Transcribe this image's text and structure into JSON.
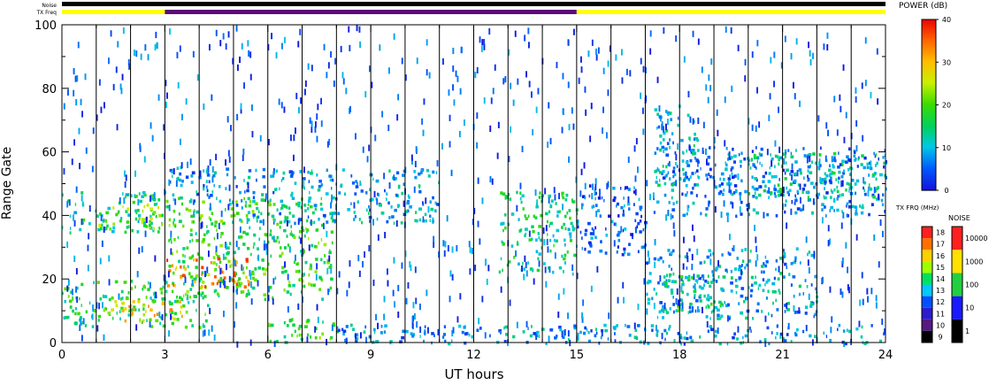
{
  "labels": {
    "noise": "Noise",
    "txfreq": "TX Freq"
  },
  "chart_data": {
    "type": "heatmap",
    "xlabel": "UT hours",
    "ylabel": "Range Gate",
    "xlim": [
      0,
      24
    ],
    "ylim": [
      0,
      100
    ],
    "x_ticks": [
      "0",
      "3",
      "6",
      "9",
      "12",
      "15",
      "18",
      "21",
      "24"
    ],
    "y_ticks": [
      "0",
      "20",
      "40",
      "60",
      "80",
      "100"
    ],
    "scan_boundaries_hours": [
      1,
      2,
      3,
      4,
      5,
      6,
      7,
      8,
      9,
      10,
      11,
      12,
      13,
      14,
      15,
      16,
      17,
      18,
      19,
      20,
      21,
      22,
      23
    ],
    "tx_freq_bar": [
      {
        "from": 0,
        "to": 3,
        "color": "#ffff00"
      },
      {
        "from": 3,
        "to": 15,
        "color": "#5a0a78"
      },
      {
        "from": 15,
        "to": 24,
        "color": "#ffff00"
      }
    ],
    "noise_bar": [
      {
        "from": 0,
        "to": 24,
        "color": "#000000"
      }
    ],
    "power_colorbar": {
      "title": "POWER (dB)",
      "ticks": [
        "0",
        "10",
        "20",
        "30",
        "40"
      ],
      "range": [
        0,
        40
      ]
    },
    "txfreq_colorbar": {
      "title": "TX FRQ (MHz)",
      "ticks": [
        "9",
        "10",
        "11",
        "12",
        "13",
        "14",
        "15",
        "16",
        "17",
        "18"
      ],
      "colors": [
        "#000000",
        "#551a80",
        "#2d1ccc",
        "#0050ff",
        "#00c8ff",
        "#00e060",
        "#a0ff00",
        "#ffd000",
        "#ff7000",
        "#ff2020"
      ]
    },
    "noise_colorbar": {
      "title": "NOISE",
      "ticks": [
        "1",
        "10",
        "100",
        "1000",
        "10000"
      ],
      "colors": [
        "#000000",
        "#1a1aff",
        "#20d040",
        "#ffe000",
        "#ff2020"
      ]
    },
    "echo_regions": [
      {
        "x0": 0.0,
        "x1": 2.9,
        "y0": 35,
        "y1": 48,
        "power": 14
      },
      {
        "x0": 1.0,
        "x1": 2.9,
        "y0": 36,
        "y1": 44,
        "power": 22
      },
      {
        "x0": 0.0,
        "x1": 4.3,
        "y0": 5,
        "y1": 20,
        "power": 16
      },
      {
        "x0": 1.2,
        "x1": 3.5,
        "y0": 7,
        "y1": 14,
        "power": 28
      },
      {
        "x0": 3.0,
        "x1": 7.9,
        "y0": 14,
        "y1": 46,
        "power": 18
      },
      {
        "x0": 3.0,
        "x1": 5.5,
        "y0": 18,
        "y1": 27,
        "power": 32
      },
      {
        "x0": 5.0,
        "x1": 11.0,
        "y0": 38,
        "y1": 55,
        "power": 9
      },
      {
        "x0": 3.0,
        "x1": 5.0,
        "y0": 44,
        "y1": 56,
        "power": 8
      },
      {
        "x0": 6.0,
        "x1": 8.0,
        "y0": 0,
        "y1": 8,
        "power": 18
      },
      {
        "x0": 8.0,
        "x1": 24.0,
        "y0": 0,
        "y1": 6,
        "power": 8
      },
      {
        "x0": 12.7,
        "x1": 15.0,
        "y0": 22,
        "y1": 48,
        "power": 14
      },
      {
        "x0": 15.0,
        "x1": 17.0,
        "y0": 28,
        "y1": 50,
        "power": 5
      },
      {
        "x0": 17.2,
        "x1": 24.0,
        "y0": 40,
        "y1": 62,
        "power": 7
      },
      {
        "x0": 17.0,
        "x1": 22.0,
        "y0": 8,
        "y1": 30,
        "power": 9
      },
      {
        "x0": 17.5,
        "x1": 19.2,
        "y0": 10,
        "y1": 22,
        "power": 15
      },
      {
        "x0": 17.2,
        "x1": 18.5,
        "y0": 50,
        "y1": 75,
        "power": 10
      },
      {
        "x0": 20.0,
        "x1": 24.0,
        "y0": 45,
        "y1": 60,
        "power": 12
      }
    ]
  }
}
